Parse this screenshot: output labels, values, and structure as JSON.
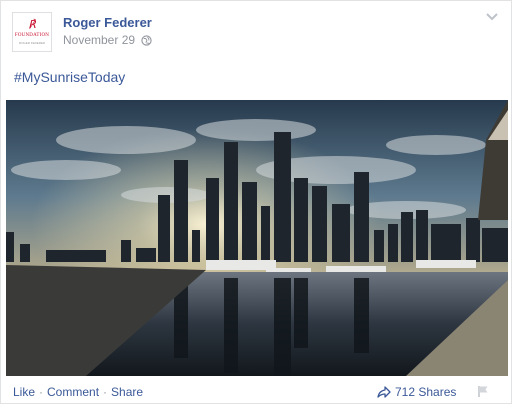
{
  "post": {
    "author": "Roger Federer",
    "date": "November 29",
    "privacy_icon": "globe-icon",
    "hashtag": "#MySunriseToday",
    "avatar": {
      "mark": "℟",
      "brand": "FOUNDATION",
      "sub": "ROGER FEDERER"
    }
  },
  "actions": {
    "like": "Like",
    "comment": "Comment",
    "share": "Share",
    "separator": "·"
  },
  "stats": {
    "shares": "712 Shares"
  },
  "colors": {
    "link": "#3b5998",
    "meta": "#90949c",
    "accent_red": "#c8102e"
  }
}
